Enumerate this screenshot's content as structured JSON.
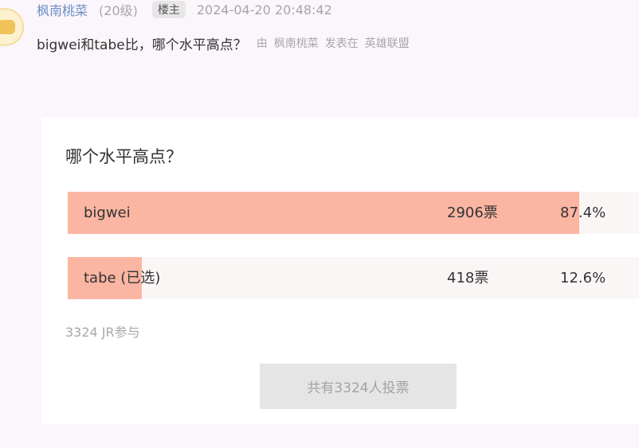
{
  "post": {
    "author": "枫南桃菜",
    "level": "(20级)",
    "badge": "楼主",
    "time": "2024-04-20 20:48:42",
    "title": "bigwei和tabe比，哪个水平高点？",
    "source_prefix": "由",
    "source_author": "枫南桃菜",
    "source_verb": "发表在",
    "source_forum": "英雄联盟"
  },
  "poll": {
    "question": "哪个水平高点？",
    "options": [
      {
        "label": "bigwei",
        "votes": "2906票",
        "percent": "87.4%",
        "fraction": 0.874,
        "selected": false
      },
      {
        "label": "tabe (已选)",
        "votes": "418票",
        "percent": "12.6%",
        "fraction": 0.126,
        "selected": true
      }
    ],
    "participants": "3324 JR参与",
    "button_label": "共有3324人投票"
  },
  "colors": {
    "option_fill": "#fbb5a3",
    "option_track": "#fbf6f6",
    "author_link": "#6e8fc6",
    "muted_text": "#a6a6a6"
  }
}
